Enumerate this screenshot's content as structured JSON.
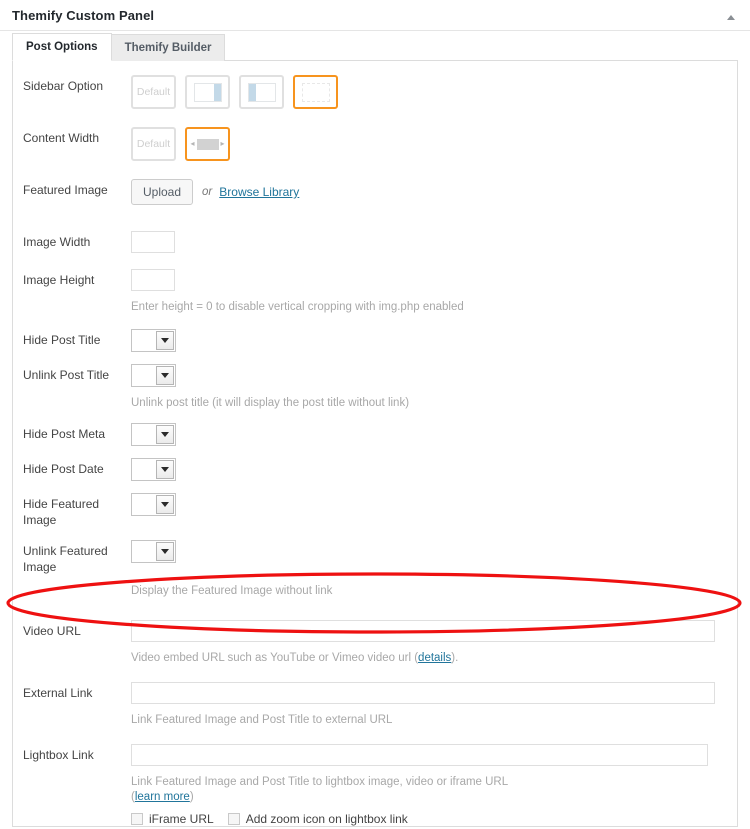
{
  "panel": {
    "title": "Themify Custom Panel",
    "toggle_icon": "chevron-up-icon"
  },
  "tabs": [
    {
      "label": "Post Options",
      "active": true
    },
    {
      "label": "Themify Builder",
      "active": false
    }
  ],
  "fields": {
    "sidebar_option": {
      "label": "Sidebar Option",
      "options": [
        {
          "name": "default",
          "text": "Default",
          "selected": false
        },
        {
          "name": "sidebar-right",
          "text": "",
          "selected": false
        },
        {
          "name": "sidebar-left",
          "text": "",
          "selected": false
        },
        {
          "name": "no-sidebar",
          "text": "",
          "selected": true
        }
      ]
    },
    "content_width": {
      "label": "Content Width",
      "options": [
        {
          "name": "default",
          "text": "Default",
          "selected": false
        },
        {
          "name": "fullwidth",
          "text": "",
          "selected": true
        }
      ]
    },
    "featured_image": {
      "label": "Featured Image",
      "upload_label": "Upload",
      "or_label": "or",
      "browse_label": "Browse Library"
    },
    "image_width": {
      "label": "Image Width",
      "value": ""
    },
    "image_height": {
      "label": "Image Height",
      "value": "",
      "hint": "Enter height = 0 to disable vertical cropping with img.php enabled"
    },
    "hide_post_title": {
      "label": "Hide Post Title",
      "value": ""
    },
    "unlink_post_title": {
      "label": "Unlink Post Title",
      "value": "",
      "hint": "Unlink post title (it will display the post title without link)"
    },
    "hide_post_meta": {
      "label": "Hide Post Meta",
      "value": ""
    },
    "hide_post_date": {
      "label": "Hide Post Date",
      "value": ""
    },
    "hide_featured_image": {
      "label": "Hide Featured Image",
      "value": ""
    },
    "unlink_featured_image": {
      "label": "Unlink Featured Image",
      "value": "",
      "hint": "Display the Featured Image without link"
    },
    "video_url": {
      "label": "Video URL",
      "value": "",
      "hint_before": "Video embed URL such as YouTube or Vimeo video url (",
      "hint_link": "details",
      "hint_after": ")."
    },
    "external_link": {
      "label": "External Link",
      "value": "",
      "hint": "Link Featured Image and Post Title to external URL"
    },
    "lightbox_link": {
      "label": "Lightbox Link",
      "value": "",
      "hint_line1": "Link Featured Image and Post Title to lightbox image, video or iframe URL",
      "hint_link_open": "(",
      "hint_link": "learn more",
      "hint_link_close": ")",
      "checkbox_iframe": "iFrame URL",
      "checkbox_zoom": "Add zoom icon on lightbox link"
    }
  },
  "colors": {
    "accent_selected": "#f7941e",
    "link": "#21759b",
    "annotation": "#ee1111",
    "hint_text": "#a8a8a8"
  }
}
